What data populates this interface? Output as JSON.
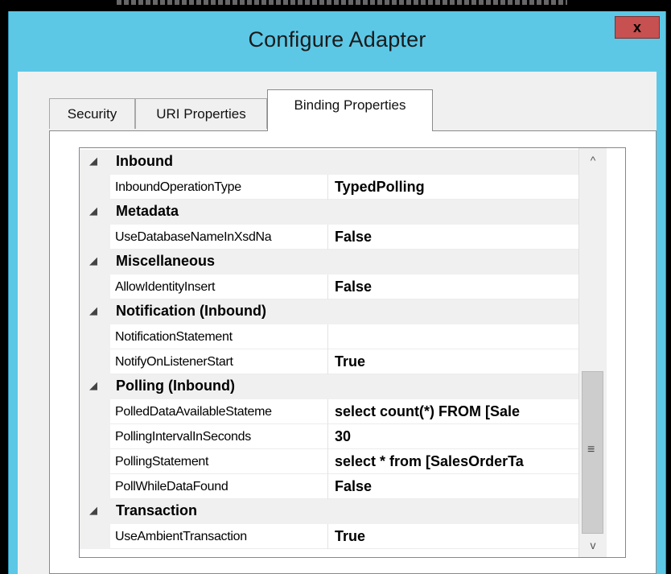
{
  "window": {
    "title": "Configure Adapter",
    "close_label": "x"
  },
  "tabs": [
    {
      "label": "Security"
    },
    {
      "label": "URI Properties"
    },
    {
      "label": "Binding Properties",
      "active": true
    }
  ],
  "grid": {
    "rows": [
      {
        "type": "category",
        "label": "Inbound"
      },
      {
        "type": "prop",
        "name": "InboundOperationType",
        "value": "TypedPolling"
      },
      {
        "type": "category",
        "label": "Metadata"
      },
      {
        "type": "prop",
        "name": "UseDatabaseNameInXsdNa",
        "value": "False"
      },
      {
        "type": "category",
        "label": "Miscellaneous"
      },
      {
        "type": "prop",
        "name": "AllowIdentityInsert",
        "value": "False"
      },
      {
        "type": "category",
        "label": "Notification (Inbound)"
      },
      {
        "type": "prop",
        "name": "NotificationStatement",
        "value": ""
      },
      {
        "type": "prop",
        "name": "NotifyOnListenerStart",
        "value": "True"
      },
      {
        "type": "category",
        "label": "Polling (Inbound)"
      },
      {
        "type": "prop",
        "name": "PolledDataAvailableStateme",
        "value": "select count(*) FROM [Sale"
      },
      {
        "type": "prop",
        "name": "PollingIntervalInSeconds",
        "value": "30"
      },
      {
        "type": "prop",
        "name": "PollingStatement",
        "value": "select * from [SalesOrderTa"
      },
      {
        "type": "prop",
        "name": "PollWhileDataFound",
        "value": "False"
      },
      {
        "type": "category",
        "label": "Transaction"
      },
      {
        "type": "prop",
        "name": "UseAmbientTransaction",
        "value": "True"
      }
    ],
    "collapse_glyph": "◢"
  },
  "scrollbar": {
    "up": "^",
    "down": "v",
    "grip": "≡"
  }
}
